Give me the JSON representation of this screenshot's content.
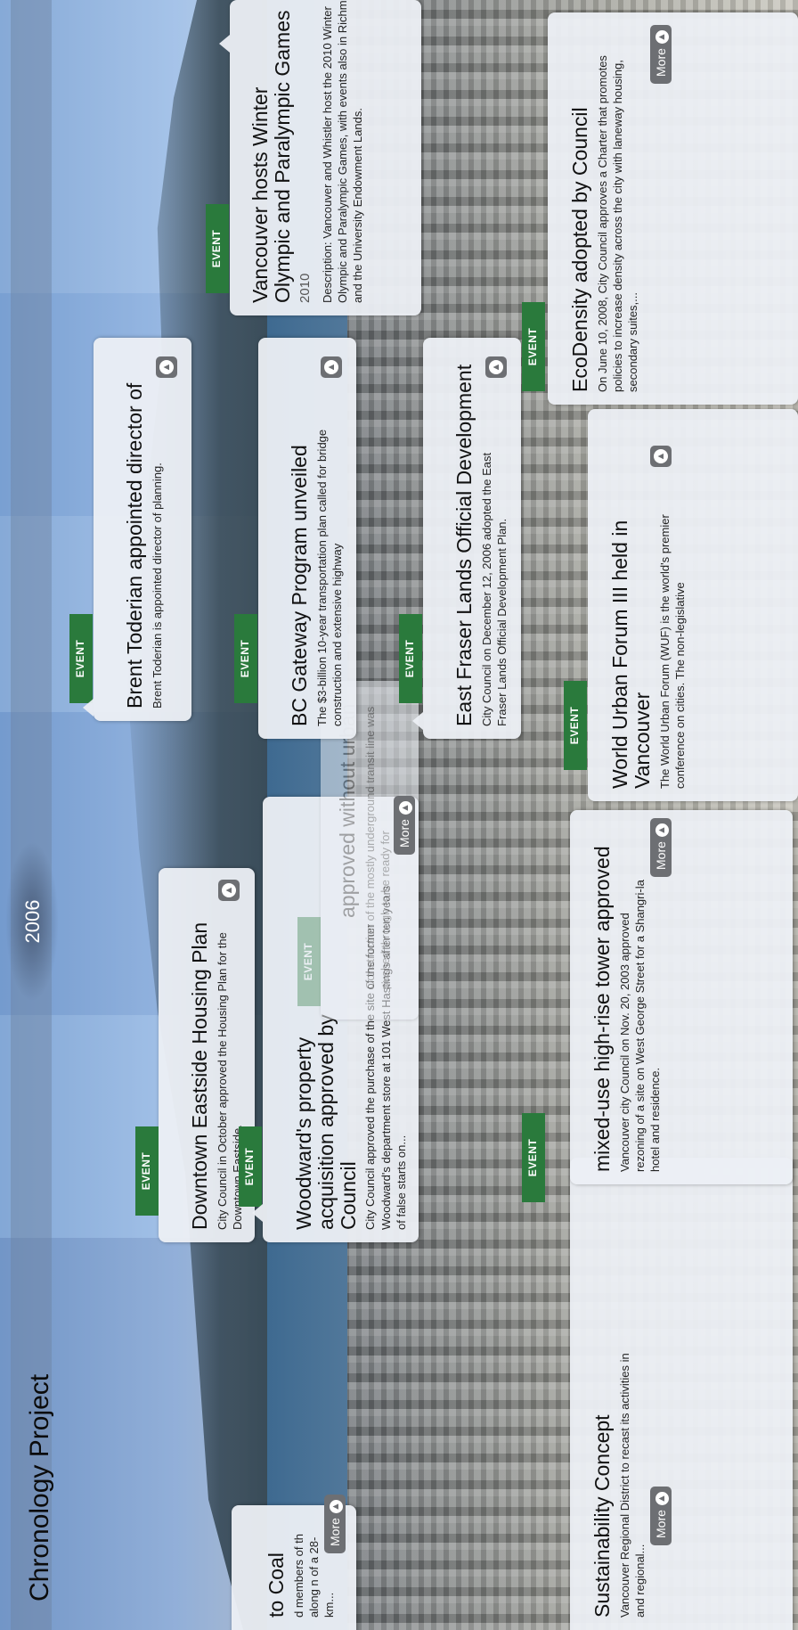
{
  "app": {
    "title": "Chronology Project"
  },
  "timeline": {
    "year_label": "2006"
  },
  "tag_label": "EVENT",
  "more_label": "More",
  "events": {
    "coal": {
      "title": "to Coal",
      "desc": "d members of th along n of a 28-km..."
    },
    "sustainability": {
      "title": "Sustainability Concept",
      "desc": "Vancouver Regional District to recast its activities in and regional..."
    },
    "downtown_eastside": {
      "title": "Downtown Eastside Housing Plan",
      "desc": "City Council in October approved the Housing Plan for the Downtown Eastside."
    },
    "woodwards": {
      "title": "Woodward's property acquisition approved by Council",
      "desc": "City Council approved the purchase of the site of the former Woodward's department store at 101 West Hastings after ten years of false starts on..."
    },
    "ghost_card": {
      "title": "approved without urban",
      "desc": "Construction of the mostly underground transit line was pushed through to be ready for"
    },
    "mixed_use": {
      "title": "mixed-use high-rise tower approved",
      "desc": "Vancouver city Council on Nov. 20, 2003 approved rezoning of a site on West George Street for a Shangri-la hotel and residence."
    },
    "toderian": {
      "title": "Brent Toderian appointed director of",
      "desc": "Brent Toderian is appointed director of planning."
    },
    "gateway": {
      "title": "BC Gateway Program unveiled",
      "desc": "The $3-billion 10-year transportation plan called for bridge construction and extensive highway"
    },
    "east_fraser": {
      "title": "East Fraser Lands Official Development",
      "desc": "City Council on December 12, 2006 adopted the East Fraser Lands Official Development Plan."
    },
    "wuf": {
      "title": "World Urban Forum III held in Vancouver",
      "desc": "The World Urban Forum (WUF) is the world's premier conference on cities. The non-legislative"
    },
    "olympics": {
      "title": "Vancouver hosts Winter Olympic and Paralympic Games",
      "year": "2010",
      "desc": "Description: Vancouver and Whistler host the 2010 Winter Olympic and Paralympic Games, with events also in Richmond and the University Endowment Lands."
    },
    "ecodensity": {
      "title": "EcoDensity adopted by Council",
      "desc": "On June 10, 2008, City Council approves a Charter that promotes policies to increase density across the city with laneway housing, secondary suites,..."
    }
  }
}
